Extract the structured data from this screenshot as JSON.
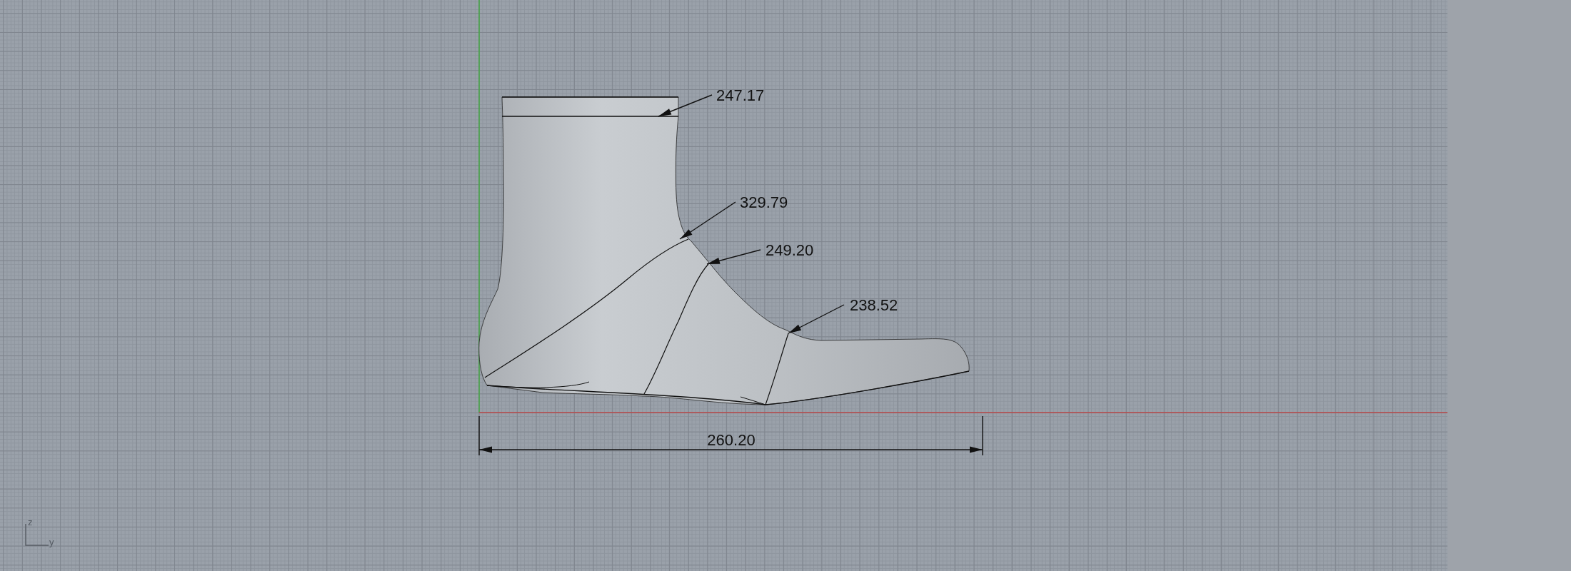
{
  "viewport": {
    "annotations": [
      {
        "kind": "leader",
        "text": "247.17"
      },
      {
        "kind": "leader",
        "text": "329.79"
      },
      {
        "kind": "leader",
        "text": "249.20"
      },
      {
        "kind": "leader",
        "text": "238.52"
      },
      {
        "kind": "linear",
        "text": "260.20"
      }
    ],
    "axis_icon": {
      "vertical_label": "z",
      "horizontal_label": "y"
    }
  }
}
